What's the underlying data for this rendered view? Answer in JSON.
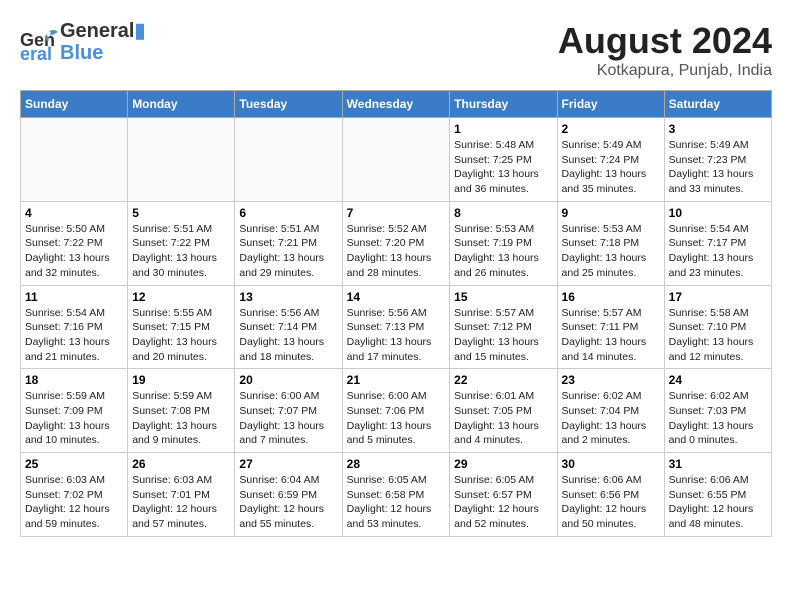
{
  "logo": {
    "line1": "General",
    "line2": "Blue"
  },
  "title": "August 2024",
  "location": "Kotkapura, Punjab, India",
  "weekdays": [
    "Sunday",
    "Monday",
    "Tuesday",
    "Wednesday",
    "Thursday",
    "Friday",
    "Saturday"
  ],
  "weeks": [
    [
      {
        "day": "",
        "info": ""
      },
      {
        "day": "",
        "info": ""
      },
      {
        "day": "",
        "info": ""
      },
      {
        "day": "",
        "info": ""
      },
      {
        "day": "1",
        "info": "Sunrise: 5:48 AM\nSunset: 7:25 PM\nDaylight: 13 hours\nand 36 minutes."
      },
      {
        "day": "2",
        "info": "Sunrise: 5:49 AM\nSunset: 7:24 PM\nDaylight: 13 hours\nand 35 minutes."
      },
      {
        "day": "3",
        "info": "Sunrise: 5:49 AM\nSunset: 7:23 PM\nDaylight: 13 hours\nand 33 minutes."
      }
    ],
    [
      {
        "day": "4",
        "info": "Sunrise: 5:50 AM\nSunset: 7:22 PM\nDaylight: 13 hours\nand 32 minutes."
      },
      {
        "day": "5",
        "info": "Sunrise: 5:51 AM\nSunset: 7:22 PM\nDaylight: 13 hours\nand 30 minutes."
      },
      {
        "day": "6",
        "info": "Sunrise: 5:51 AM\nSunset: 7:21 PM\nDaylight: 13 hours\nand 29 minutes."
      },
      {
        "day": "7",
        "info": "Sunrise: 5:52 AM\nSunset: 7:20 PM\nDaylight: 13 hours\nand 28 minutes."
      },
      {
        "day": "8",
        "info": "Sunrise: 5:53 AM\nSunset: 7:19 PM\nDaylight: 13 hours\nand 26 minutes."
      },
      {
        "day": "9",
        "info": "Sunrise: 5:53 AM\nSunset: 7:18 PM\nDaylight: 13 hours\nand 25 minutes."
      },
      {
        "day": "10",
        "info": "Sunrise: 5:54 AM\nSunset: 7:17 PM\nDaylight: 13 hours\nand 23 minutes."
      }
    ],
    [
      {
        "day": "11",
        "info": "Sunrise: 5:54 AM\nSunset: 7:16 PM\nDaylight: 13 hours\nand 21 minutes."
      },
      {
        "day": "12",
        "info": "Sunrise: 5:55 AM\nSunset: 7:15 PM\nDaylight: 13 hours\nand 20 minutes."
      },
      {
        "day": "13",
        "info": "Sunrise: 5:56 AM\nSunset: 7:14 PM\nDaylight: 13 hours\nand 18 minutes."
      },
      {
        "day": "14",
        "info": "Sunrise: 5:56 AM\nSunset: 7:13 PM\nDaylight: 13 hours\nand 17 minutes."
      },
      {
        "day": "15",
        "info": "Sunrise: 5:57 AM\nSunset: 7:12 PM\nDaylight: 13 hours\nand 15 minutes."
      },
      {
        "day": "16",
        "info": "Sunrise: 5:57 AM\nSunset: 7:11 PM\nDaylight: 13 hours\nand 14 minutes."
      },
      {
        "day": "17",
        "info": "Sunrise: 5:58 AM\nSunset: 7:10 PM\nDaylight: 13 hours\nand 12 minutes."
      }
    ],
    [
      {
        "day": "18",
        "info": "Sunrise: 5:59 AM\nSunset: 7:09 PM\nDaylight: 13 hours\nand 10 minutes."
      },
      {
        "day": "19",
        "info": "Sunrise: 5:59 AM\nSunset: 7:08 PM\nDaylight: 13 hours\nand 9 minutes."
      },
      {
        "day": "20",
        "info": "Sunrise: 6:00 AM\nSunset: 7:07 PM\nDaylight: 13 hours\nand 7 minutes."
      },
      {
        "day": "21",
        "info": "Sunrise: 6:00 AM\nSunset: 7:06 PM\nDaylight: 13 hours\nand 5 minutes."
      },
      {
        "day": "22",
        "info": "Sunrise: 6:01 AM\nSunset: 7:05 PM\nDaylight: 13 hours\nand 4 minutes."
      },
      {
        "day": "23",
        "info": "Sunrise: 6:02 AM\nSunset: 7:04 PM\nDaylight: 13 hours\nand 2 minutes."
      },
      {
        "day": "24",
        "info": "Sunrise: 6:02 AM\nSunset: 7:03 PM\nDaylight: 13 hours\nand 0 minutes."
      }
    ],
    [
      {
        "day": "25",
        "info": "Sunrise: 6:03 AM\nSunset: 7:02 PM\nDaylight: 12 hours\nand 59 minutes."
      },
      {
        "day": "26",
        "info": "Sunrise: 6:03 AM\nSunset: 7:01 PM\nDaylight: 12 hours\nand 57 minutes."
      },
      {
        "day": "27",
        "info": "Sunrise: 6:04 AM\nSunset: 6:59 PM\nDaylight: 12 hours\nand 55 minutes."
      },
      {
        "day": "28",
        "info": "Sunrise: 6:05 AM\nSunset: 6:58 PM\nDaylight: 12 hours\nand 53 minutes."
      },
      {
        "day": "29",
        "info": "Sunrise: 6:05 AM\nSunset: 6:57 PM\nDaylight: 12 hours\nand 52 minutes."
      },
      {
        "day": "30",
        "info": "Sunrise: 6:06 AM\nSunset: 6:56 PM\nDaylight: 12 hours\nand 50 minutes."
      },
      {
        "day": "31",
        "info": "Sunrise: 6:06 AM\nSunset: 6:55 PM\nDaylight: 12 hours\nand 48 minutes."
      }
    ]
  ]
}
